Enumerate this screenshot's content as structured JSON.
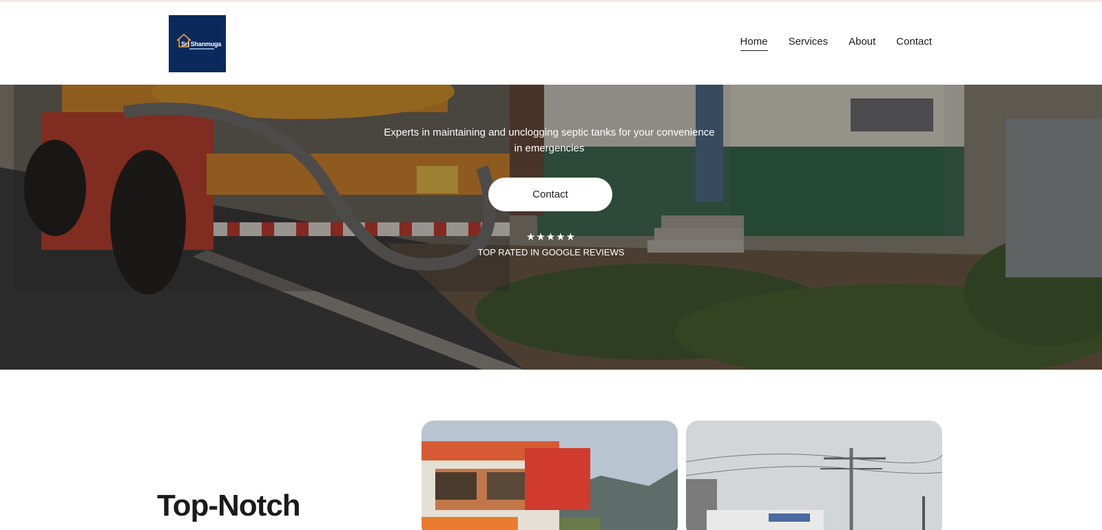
{
  "brand": {
    "logo_text": "Sri Shanmuga",
    "logo_color": "#0b2a5b"
  },
  "nav": {
    "items": [
      {
        "label": "Home",
        "active": true
      },
      {
        "label": "Services",
        "active": false
      },
      {
        "label": "About",
        "active": false
      },
      {
        "label": "Contact",
        "active": false
      }
    ]
  },
  "hero": {
    "tagline": "Experts in maintaining and unclogging septic tanks for your convenience in emergencies",
    "cta_label": "Contact",
    "stars": "★★★★★",
    "rating_label": "TOP RATED IN GOOGLE REVIEWS"
  },
  "section": {
    "title": "Top-Notch"
  },
  "colors": {
    "accent": "#0b2a5b",
    "text": "#1b1b1b"
  }
}
